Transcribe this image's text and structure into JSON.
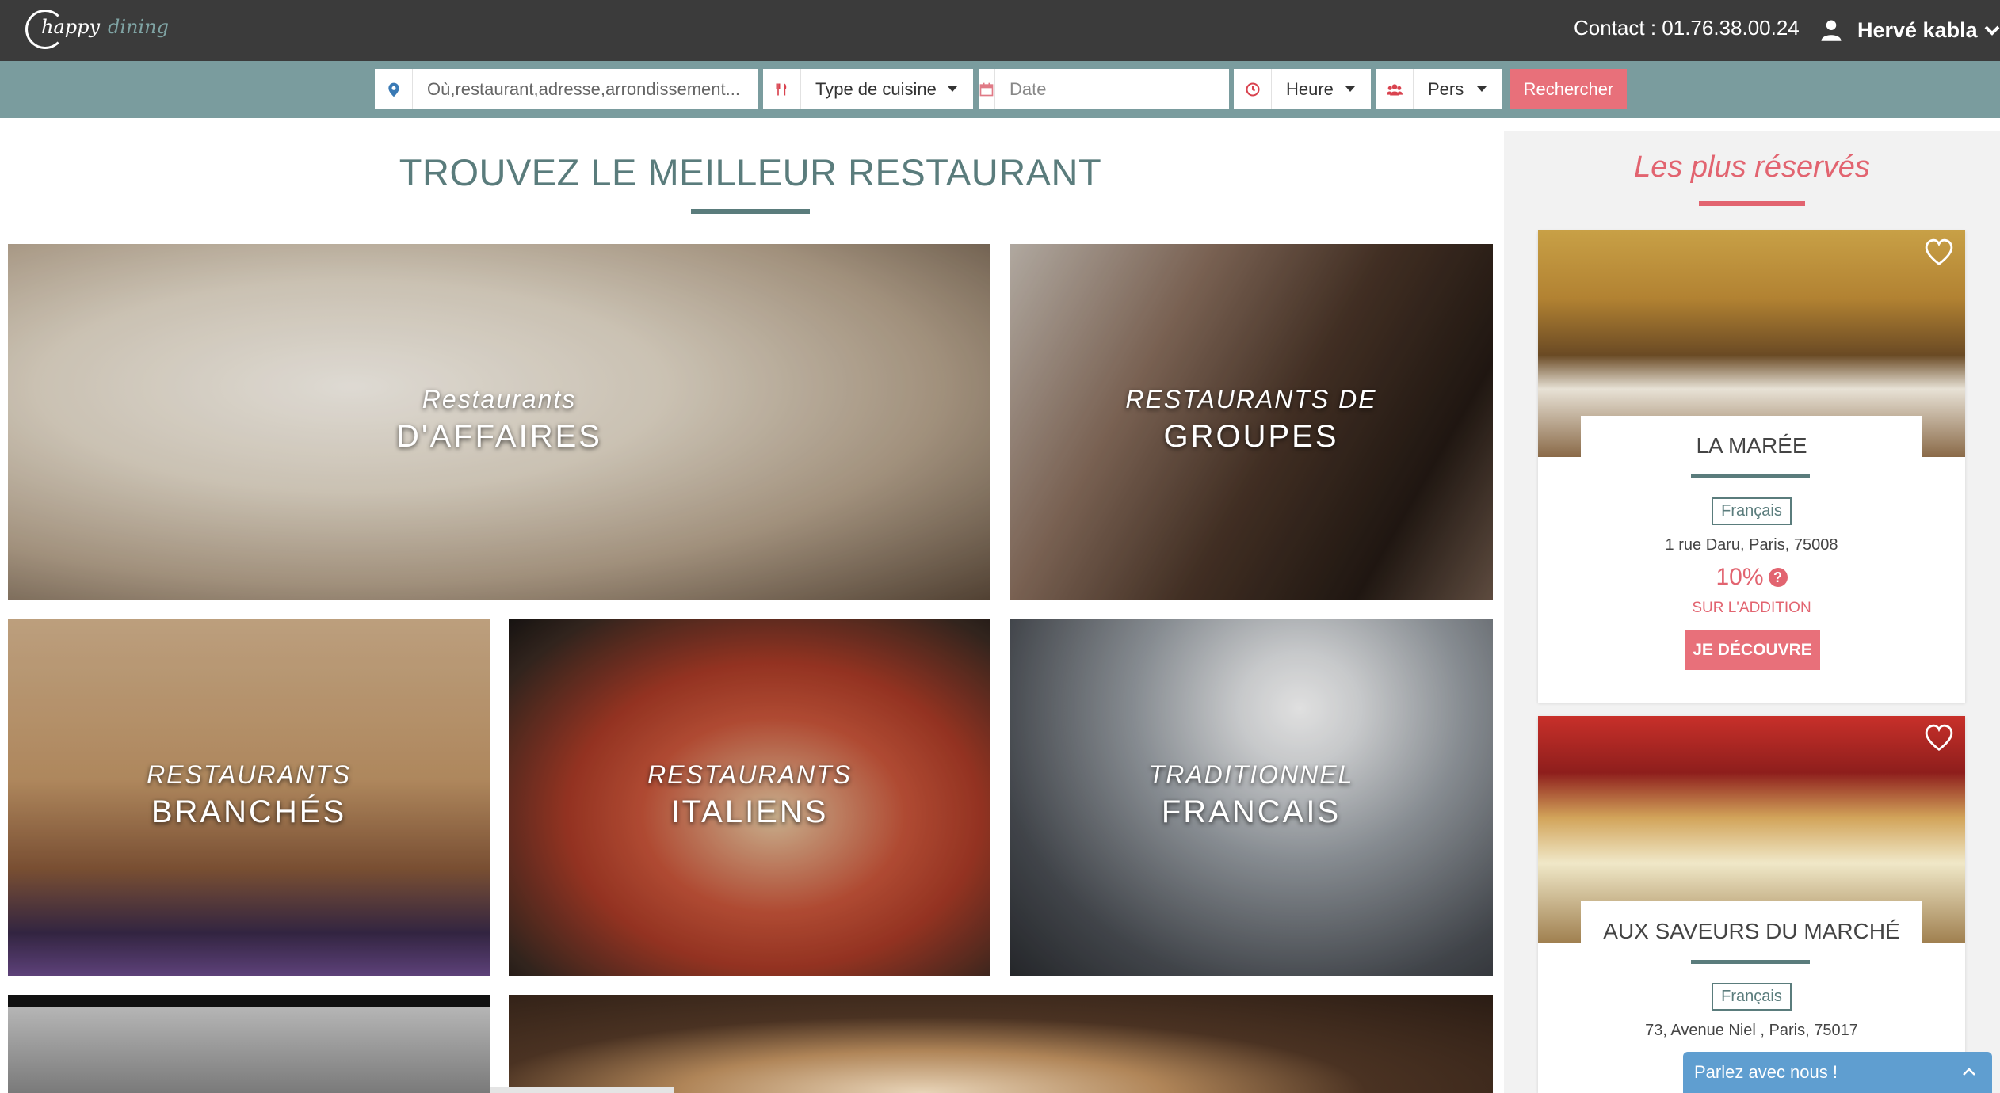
{
  "header": {
    "logo_happy": "happy",
    "logo_dining": "dining",
    "contact": "Contact : 01.76.38.00.24",
    "user_name": "Hervé kabla"
  },
  "search": {
    "location_placeholder": "Où,restaurant,adresse,arrondissement...",
    "cuisine_label": "Type de cuisine",
    "date_placeholder": "Date",
    "heure_label": "Heure",
    "pers_label": "Pers",
    "submit_label": "Rechercher"
  },
  "main": {
    "title": "TROUVEZ LE MEILLEUR RESTAURANT",
    "tiles": [
      {
        "line1": "Restaurants",
        "line2": "D'AFFAIRES"
      },
      {
        "line1": "RESTAURANTS DE",
        "line2": "GROUPES"
      },
      {
        "line1": "RESTAURANTS",
        "line2": "BRANCHÉS"
      },
      {
        "line1": "RESTAURANTS",
        "line2": "ITALIENS"
      },
      {
        "line1": "TRADITIONNEL",
        "line2": "FRANCAIS"
      }
    ]
  },
  "sidebar": {
    "title": "Les plus réservés",
    "cards": [
      {
        "name": "LA MARÉE",
        "cuisine": "Français",
        "address": "1 rue Daru, Paris, 75008",
        "discount": "10%",
        "discount_sub": "SUR L'ADDITION",
        "cta": "JE DÉCOUVRE"
      },
      {
        "name": "AUX SAVEURS DU MARCHÉ",
        "cuisine": "Français",
        "address": "73, Avenue Niel , Paris, 75017"
      }
    ]
  },
  "chat": {
    "label": "Parlez avec nous !"
  },
  "colors": {
    "header_bg": "#3b3b3b",
    "search_bg": "#7a9c9e",
    "accent_teal": "#5a7c7c",
    "accent_pink": "#e26470",
    "button_pink": "#e8707a",
    "chat_blue": "#5f9ed0"
  }
}
